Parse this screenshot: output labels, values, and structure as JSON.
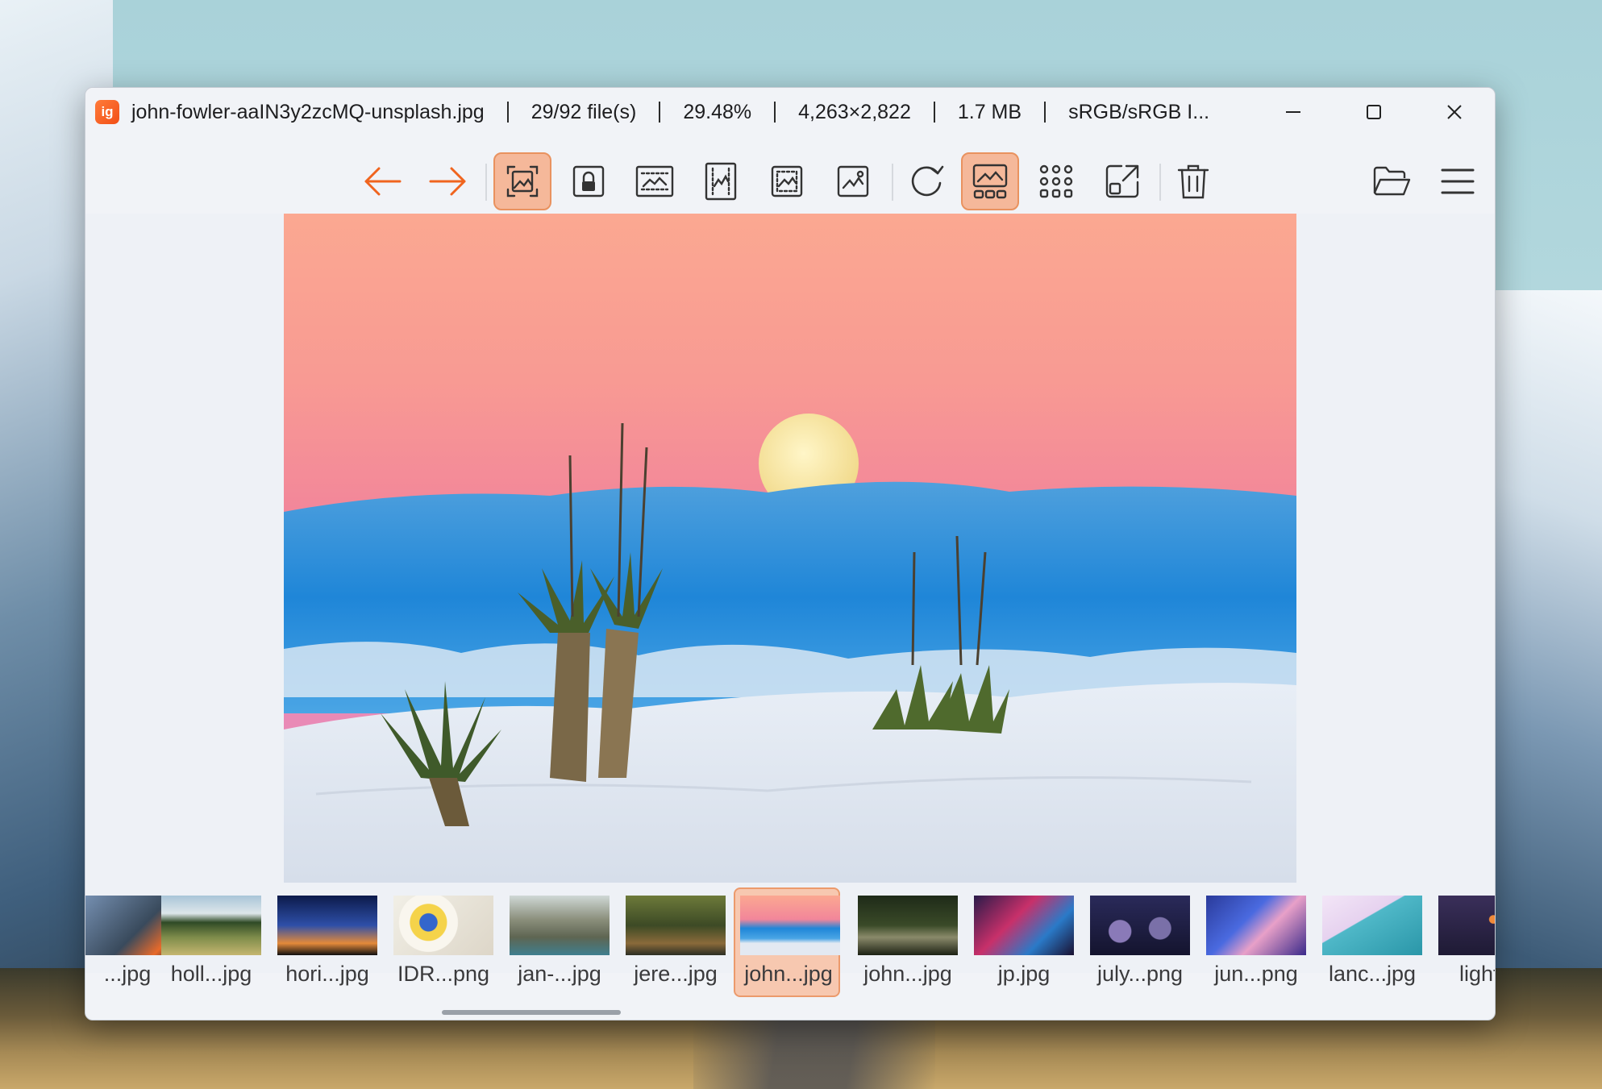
{
  "window": {
    "file_name": "john-fowler-aaIN3y2zcMQ-unsplash.jpg",
    "file_count": "29/92 file(s)",
    "zoom": "29.48%",
    "dimensions": "4,263×2,822",
    "file_size": "1.7 MB",
    "color_profile": "sRGB/sRGB I...",
    "app_logo_text": "ig",
    "accent_color": "#f0641e",
    "active_color": "#f5b89a"
  },
  "toolbar": {
    "buttons": [
      {
        "icon": "arrow-left-icon"
      },
      {
        "icon": "arrow-right-icon"
      },
      {
        "icon": "auto-zoom-icon",
        "active": true
      },
      {
        "icon": "lock-zoom-icon"
      },
      {
        "icon": "scale-to-width-icon"
      },
      {
        "icon": "scale-to-height-icon"
      },
      {
        "icon": "scale-to-fit-icon"
      },
      {
        "icon": "original-size-icon"
      },
      {
        "icon": "refresh-icon"
      },
      {
        "icon": "gallery-icon",
        "active": true
      },
      {
        "icon": "thumbnail-grid-icon"
      },
      {
        "icon": "open-external-icon"
      },
      {
        "icon": "delete-icon"
      },
      {
        "icon": "open-folder-icon"
      },
      {
        "icon": "hamburger-menu-icon"
      }
    ]
  },
  "thumbnails": [
    {
      "label": "...jpg"
    },
    {
      "label": "holl...jpg"
    },
    {
      "label": "hori...jpg"
    },
    {
      "label": "IDR...png"
    },
    {
      "label": "jan-...jpg"
    },
    {
      "label": "jere...jpg"
    },
    {
      "label": "john...jpg",
      "active": true
    },
    {
      "label": "john...jpg"
    },
    {
      "label": "jp.jpg"
    },
    {
      "label": "july...png"
    },
    {
      "label": "jun...png"
    },
    {
      "label": "lanc...jpg"
    },
    {
      "label": "light..."
    }
  ]
}
